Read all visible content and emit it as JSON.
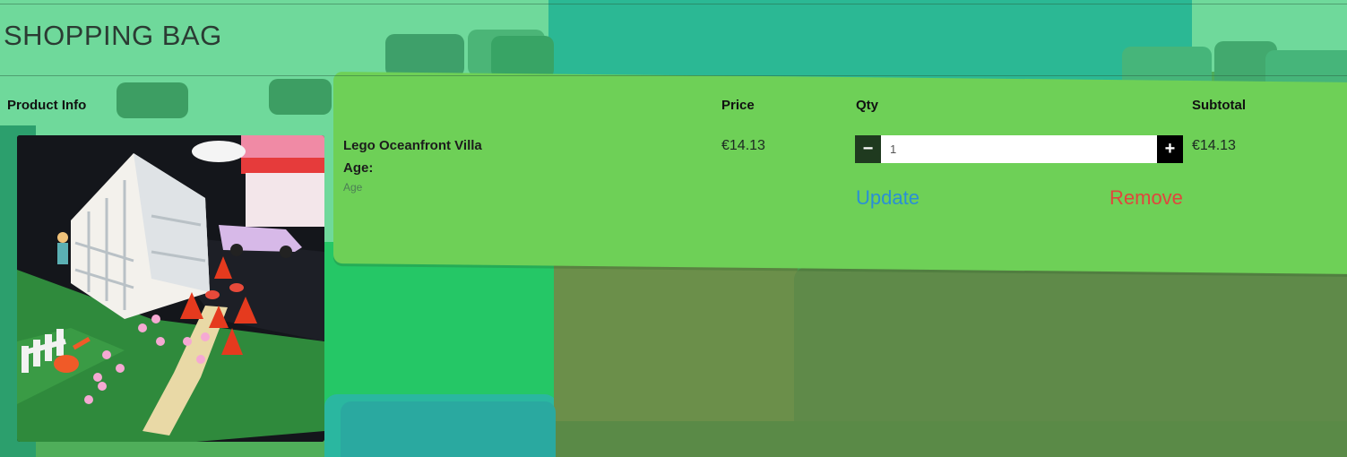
{
  "page": {
    "title": "SHOPPING BAG"
  },
  "table": {
    "headers": {
      "product_info": "Product Info",
      "price": "Price",
      "qty": "Qty",
      "subtotal": "Subtotal"
    }
  },
  "item": {
    "name": "Lego Oceanfront Villa",
    "age_label": "Age:",
    "age_value": "Age",
    "price": "€14.13",
    "quantity": "1",
    "subtotal": "€14.13",
    "image_alt": "Lego greenhouse and garden set"
  },
  "actions": {
    "decrement_symbol": "−",
    "increment_symbol": "+",
    "update_label": "Update",
    "remove_label": "Remove"
  },
  "colors": {
    "update_link": "#2a8fd6",
    "remove_link": "#e0463d",
    "minus_button": "#1f3a1f",
    "plus_button": "#000000"
  }
}
